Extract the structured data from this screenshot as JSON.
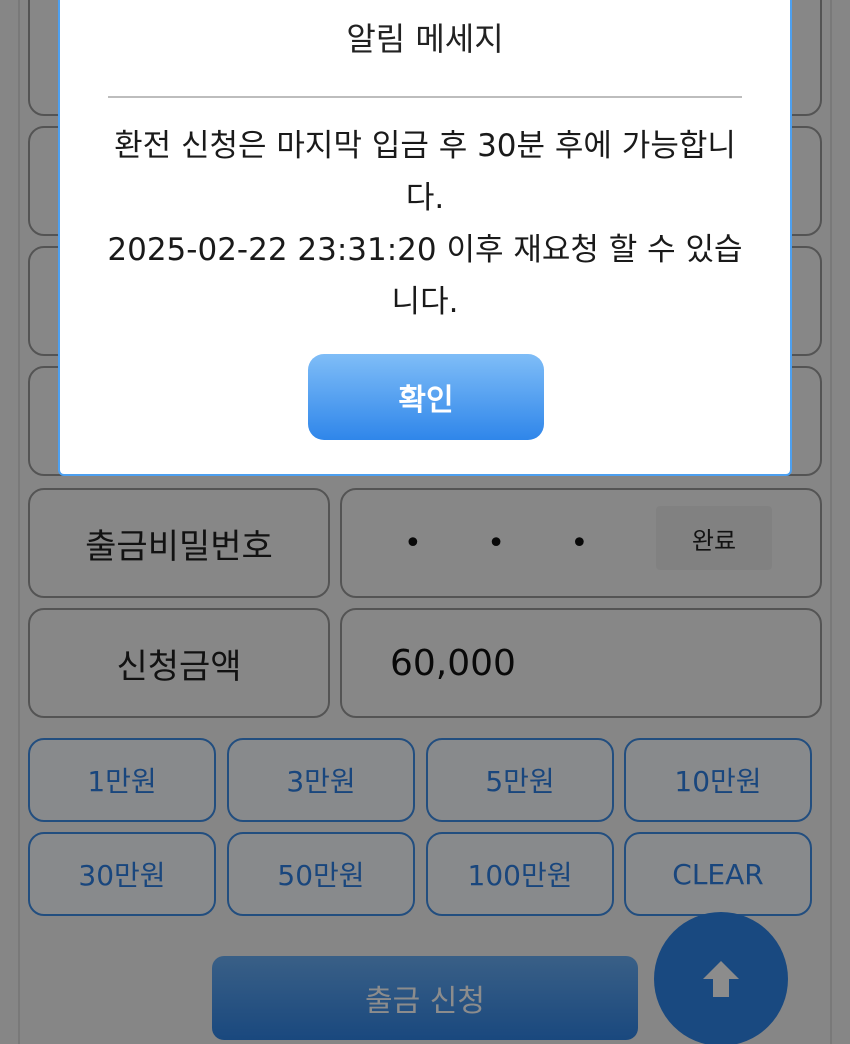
{
  "form": {
    "password_label": "출금비밀번호",
    "password_value": "• • • •",
    "done_label": "완료",
    "amount_label": "신청금액",
    "amount_value": "60,000"
  },
  "quick_amounts": [
    "1만원",
    "3만원",
    "5만원",
    "10만원",
    "30만원",
    "50만원",
    "100만원",
    "CLEAR"
  ],
  "submit_label": "출금 신청",
  "modal": {
    "title": "알림 메세지",
    "message_line1": "환전 신청은 마지막 입금 후 30분 후에 가능합니다.",
    "message_line2": "2025-02-22 23:31:20 이후 재요청 할 수 있습니다.",
    "confirm_label": "확인"
  },
  "colors": {
    "accent": "#2f86ea",
    "modal_border": "#4da0f0"
  },
  "icons": {
    "scroll_top": "arrow-up-icon"
  }
}
